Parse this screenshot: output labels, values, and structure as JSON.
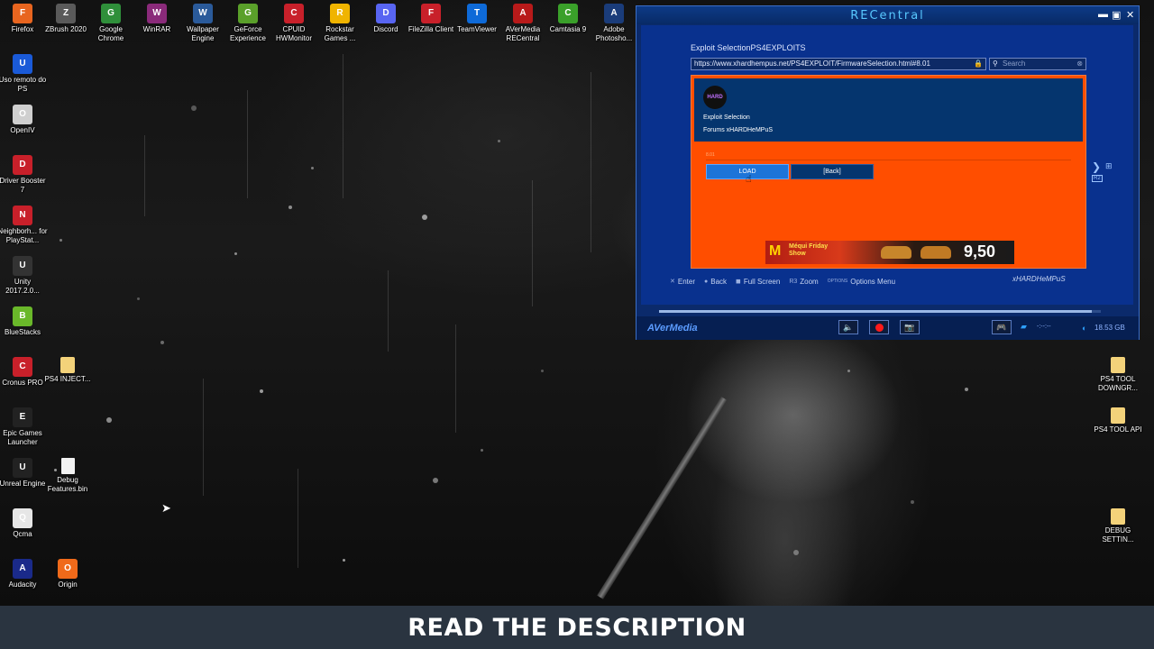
{
  "desktop": {
    "icons_top": [
      {
        "label": "Firefox",
        "icon": "firefox-icon",
        "color": "#e8651f"
      },
      {
        "label": "ZBrush 2020",
        "icon": "zbrush-icon",
        "color": "#5a5a5a"
      },
      {
        "label": "Google Chrome",
        "icon": "chrome-icon",
        "color": "#2f8f3a"
      },
      {
        "label": "WinRAR",
        "icon": "winrar-icon",
        "color": "#8a2a7a"
      },
      {
        "label": "Wallpaper Engine",
        "icon": "wallpaper-engine-icon",
        "color": "#2a5a9a"
      },
      {
        "label": "GeForce Experience",
        "icon": "geforce-icon",
        "color": "#5aa02a"
      },
      {
        "label": "CPUID HWMonitor",
        "icon": "hwmonitor-icon",
        "color": "#c8202a"
      },
      {
        "label": "Rockstar Games ...",
        "icon": "rockstar-icon",
        "color": "#f0b400"
      },
      {
        "label": "Discord",
        "icon": "discord-icon",
        "color": "#5865f2"
      },
      {
        "label": "FileZilla Client",
        "icon": "filezilla-icon",
        "color": "#c8202a"
      },
      {
        "label": "TeamViewer",
        "icon": "teamviewer-icon",
        "color": "#0e6ad8"
      },
      {
        "label": "AVerMedia RECentral",
        "icon": "avermedia-icon",
        "color": "#b81a1a"
      },
      {
        "label": "Camtasia 9",
        "icon": "camtasia-icon",
        "color": "#3aa02a"
      },
      {
        "label": "Adobe Photosho...",
        "icon": "photoshop-icon",
        "color": "#1a3c7a"
      }
    ],
    "icons_left": [
      {
        "label": "Uso remoto do PS",
        "icon": "remote-play-icon",
        "color": "#1a5ad8"
      },
      {
        "label": "OpenIV",
        "icon": "openiv-icon",
        "color": "#cfcfcf"
      },
      {
        "label": "Driver Booster 7",
        "icon": "driver-booster-icon",
        "color": "#c8202a"
      },
      {
        "label": "Neighborh... for PlayStat...",
        "icon": "neighborhood-icon",
        "color": "#c8202a"
      },
      {
        "label": "Unity 2017.2.0...",
        "icon": "unity-icon",
        "color": "#333333"
      },
      {
        "label": "BlueStacks",
        "icon": "bluestacks-icon",
        "color": "#6ab82a"
      },
      {
        "label": "Cronus PRO",
        "icon": "cronus-icon",
        "color": "#c8202a"
      },
      {
        "label": "Epic Games Launcher",
        "icon": "epic-games-icon",
        "color": "#222222"
      },
      {
        "label": "Unreal Engine",
        "icon": "unreal-icon",
        "color": "#222222"
      },
      {
        "label": "Qcma",
        "icon": "qcma-icon",
        "color": "#e6e6e6"
      },
      {
        "label": "Audacity",
        "icon": "audacity-icon",
        "color": "#1a2a8a"
      }
    ],
    "icons_second_col": [
      {
        "label": "PS4 INJECT...",
        "icon": "folder-icon",
        "color": "#f3d27a"
      },
      {
        "label": "Debug Features.bin",
        "icon": "file-icon",
        "color": "#f2f2f2"
      },
      {
        "label": "Origin",
        "icon": "origin-icon",
        "color": "#f06a1a"
      }
    ],
    "icons_right": [
      {
        "label": "PS4 TOOL DOWNGR...",
        "icon": "folder-icon",
        "color": "#f3d27a"
      },
      {
        "label": "PS4 TOOL API",
        "icon": "folder-icon",
        "color": "#f3d27a"
      },
      {
        "label": "DEBUG SETTIN...",
        "icon": "folder-icon",
        "color": "#f3d27a"
      }
    ]
  },
  "recentral": {
    "title": "RECentral",
    "window_controls": {
      "minimize": "▬",
      "maximize": "▣",
      "close": "✕"
    },
    "browser": {
      "breadcrumb": "Exploit SelectionPS4EXPLOITS",
      "url": "https://www.xhardhempus.net/PS4EXPLOIT/FirmwareSelection.html#8.01",
      "search_placeholder": "Search",
      "page_logo": "HARD",
      "page_title": "Exploit Selection",
      "page_subtitle": "Forums xHARDHeMPuS",
      "version": "8.01",
      "load_label": "LOAD",
      "back_label": "[Back]",
      "ad_brand": "M",
      "ad_text": "Méqui Friday Show",
      "ad_price": "9,50"
    },
    "ps_controls": [
      {
        "icon": "cross-button-icon",
        "glyph": "✕",
        "label": "Enter"
      },
      {
        "icon": "circle-button-icon",
        "glyph": "●",
        "label": "Back"
      },
      {
        "icon": "square-button-icon",
        "glyph": "◼",
        "label": "Full Screen"
      },
      {
        "icon": "r3-button-icon",
        "glyph": "R3",
        "label": "Zoom"
      },
      {
        "icon": "options-button-icon",
        "glyph": "OPTIONS",
        "label": "Options Menu"
      }
    ],
    "ps_user": "xHARDHeMPuS",
    "progress": 0.98,
    "brand": "AVerMedia",
    "storage": "18.53 GB",
    "accent": "#58c8ff"
  },
  "banner": {
    "text": "READ THE DESCRIPTION"
  }
}
